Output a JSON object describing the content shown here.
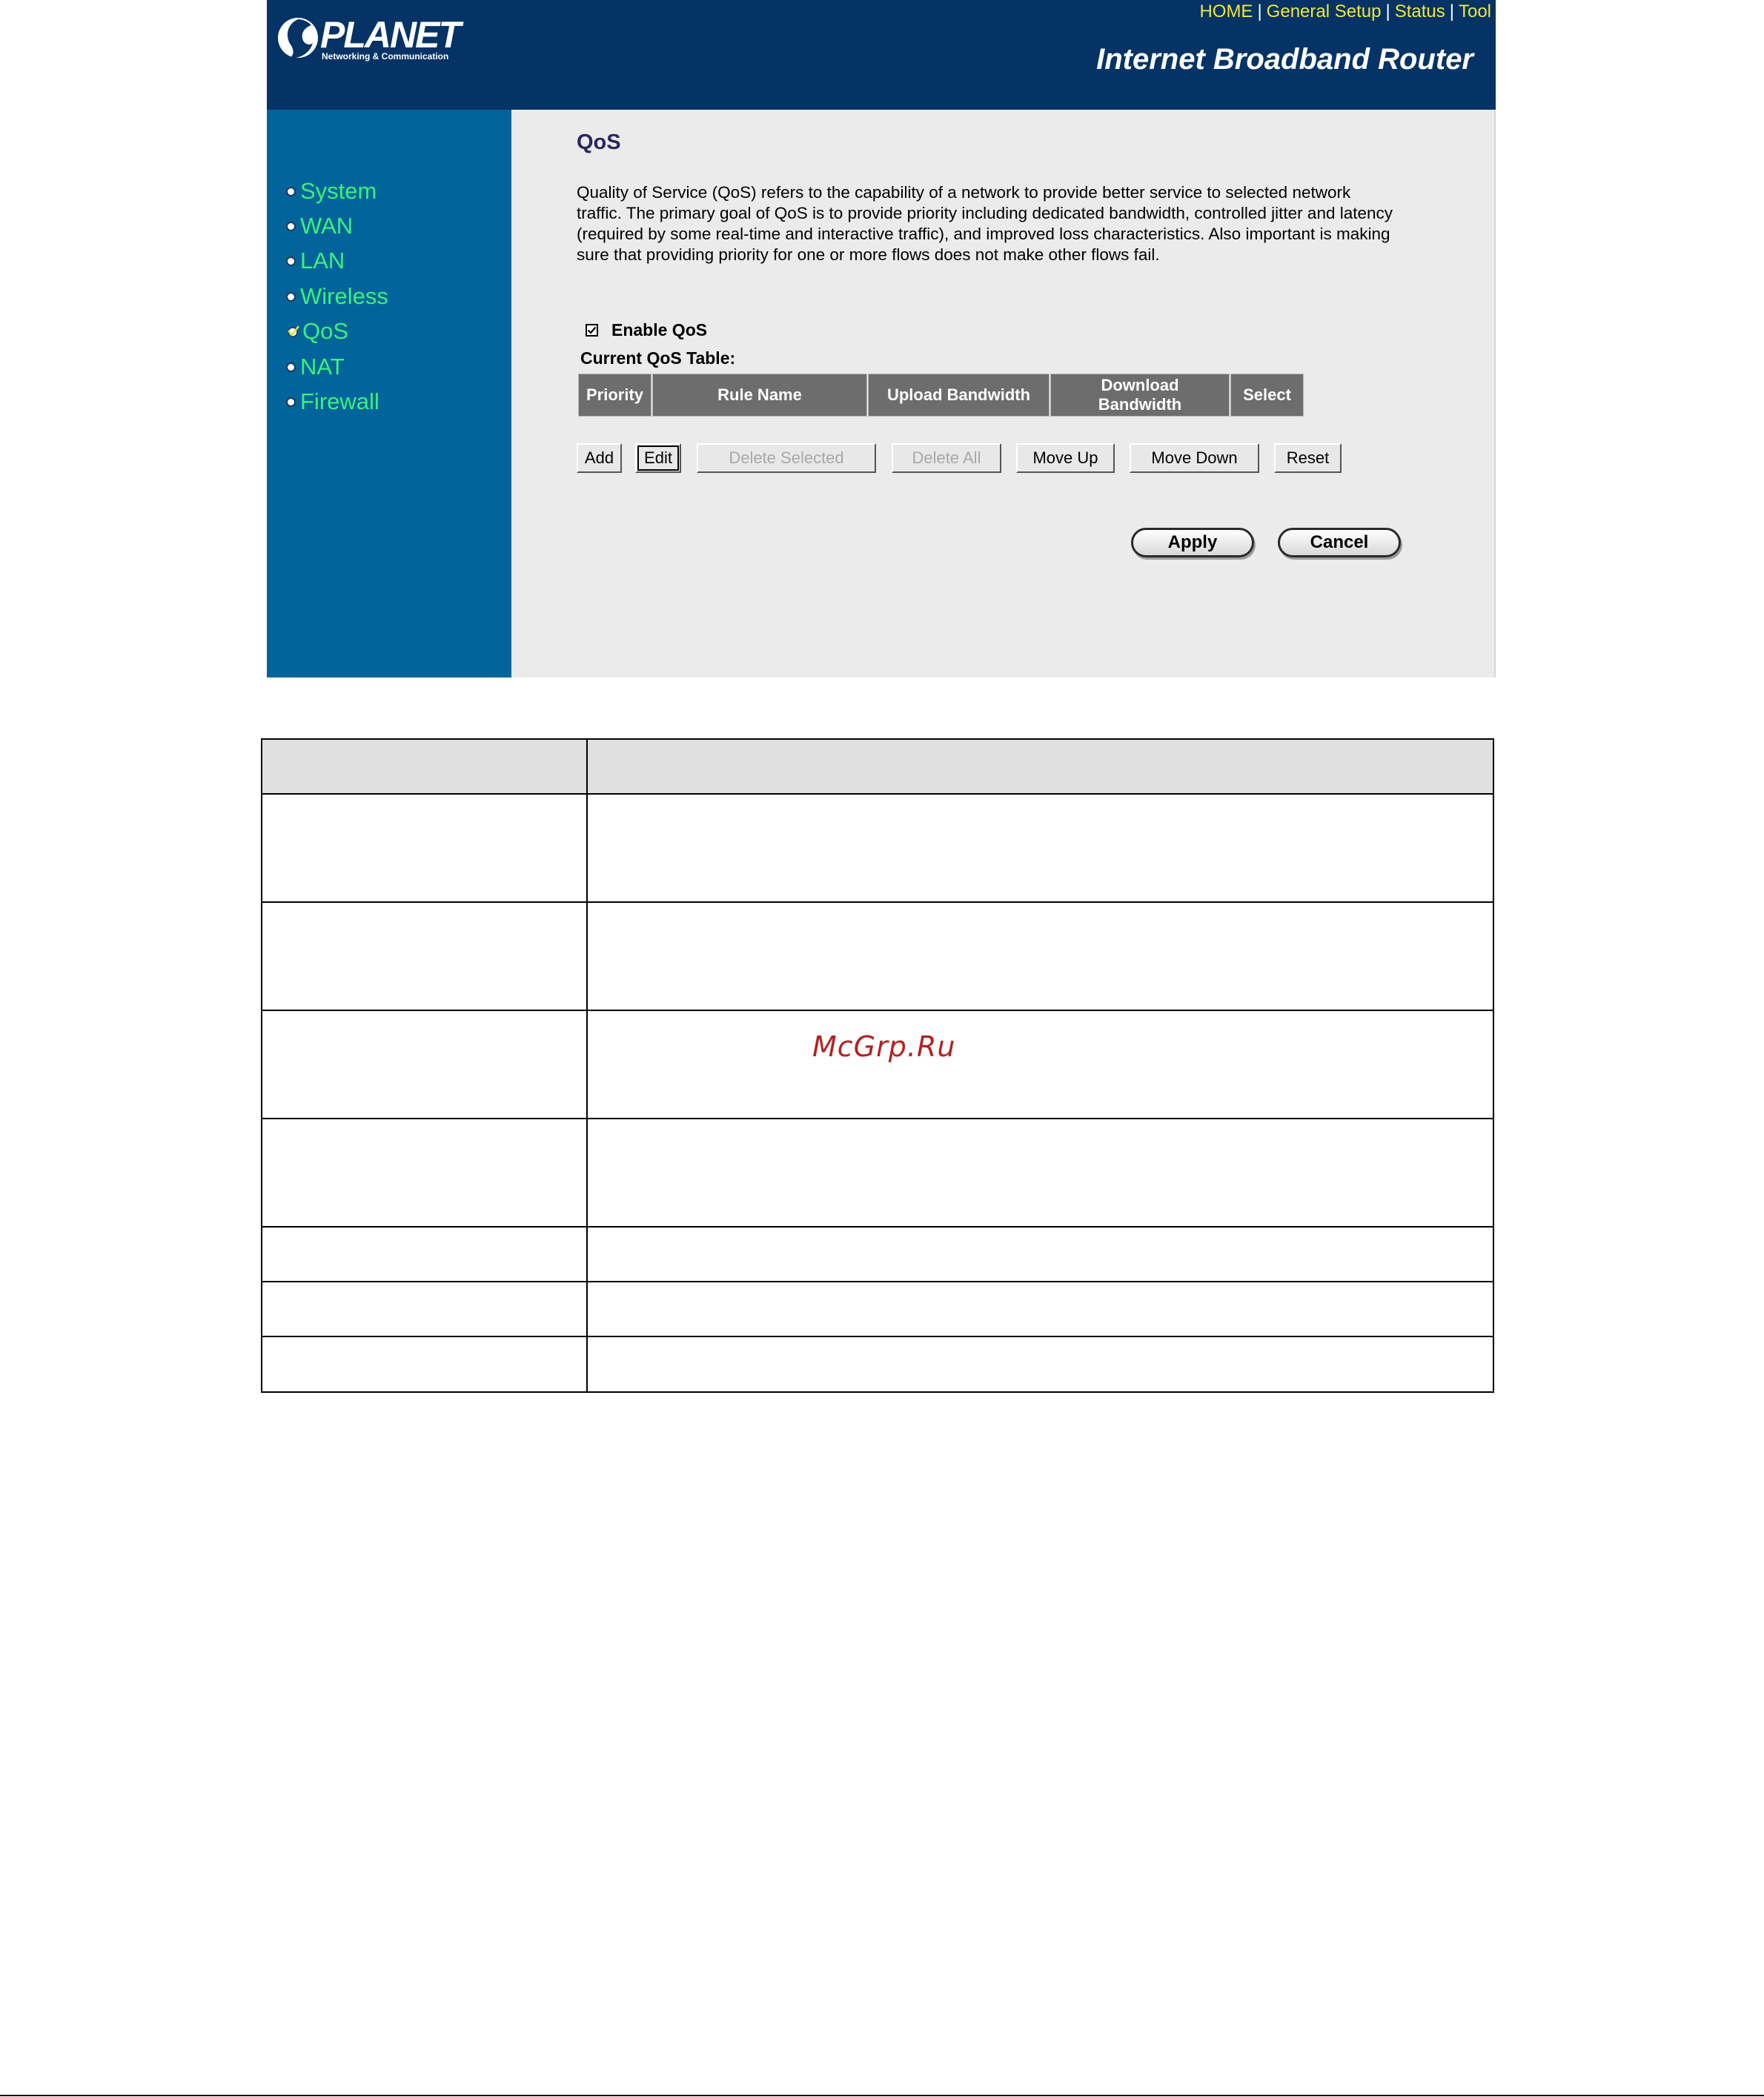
{
  "header": {
    "logo_word": "PLANET",
    "logo_tagline": "Networking & Communication",
    "links": [
      "HOME",
      "General Setup",
      "Status",
      "Tool"
    ],
    "product_title": "Internet Broadband Router"
  },
  "sidebar": {
    "items": [
      {
        "label": "System",
        "state": "radio"
      },
      {
        "label": "WAN",
        "state": "radio"
      },
      {
        "label": "LAN",
        "state": "radio"
      },
      {
        "label": "Wireless",
        "state": "radio"
      },
      {
        "label": "QoS",
        "state": "checked"
      },
      {
        "label": "NAT",
        "state": "radio"
      },
      {
        "label": "Firewall",
        "state": "radio"
      }
    ]
  },
  "main": {
    "title": "QoS",
    "intro_lines": [
      "Quality of Service (QoS) refers to the capability of a network to provide better service to selected network",
      "traffic. The primary goal of QoS is to provide priority including dedicated bandwidth, controlled jitter and latency",
      "(required by some real-time and interactive traffic), and improved loss characteristics. Also important is making",
      "sure that providing priority for one or more flows does not make other flows fail."
    ],
    "enable_qos": {
      "label": "Enable QoS",
      "checked": true
    },
    "table_caption": "Current QoS Table:",
    "table_headers": [
      "Priority",
      "Rule Name",
      "Upload Bandwidth",
      "Download Bandwidth",
      "Select"
    ],
    "buttons": {
      "add": "Add",
      "edit": "Edit",
      "delete_selected": "Delete Selected",
      "delete_all": "Delete All",
      "move_up": "Move Up",
      "move_down": "Move Down",
      "reset": "Reset"
    },
    "apply": "Apply",
    "cancel": "Cancel"
  },
  "watermark": "McGrp.Ru",
  "colors": {
    "header_bg": "#053365",
    "sidebar_bg": "#03649b",
    "nav_text": "#39f27a",
    "link_text": "#f2e63c",
    "content_bg": "#ebebeb",
    "table_header_bg": "#6d6d6d",
    "watermark": "#b22222"
  }
}
